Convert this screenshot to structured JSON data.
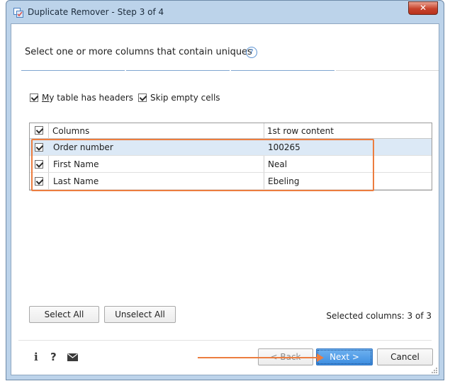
{
  "window": {
    "title": "Duplicate Remover - Step 3 of 4",
    "close_label": "✕"
  },
  "header": {
    "instruction": "Select one or more columns that contain uniques",
    "help_glyph": "?"
  },
  "options": {
    "has_headers_prefix": "M",
    "has_headers_rest": "y table has headers",
    "has_headers_checked": true,
    "skip_empty_label": "Skip empty cells",
    "skip_empty_checked": true
  },
  "grid": {
    "columns": [
      "Columns",
      "1st row content"
    ],
    "rows": [
      {
        "name": "Order number",
        "content": "100265",
        "checked": true
      },
      {
        "name": "First Name",
        "content": "Neal",
        "checked": true
      },
      {
        "name": "Last Name",
        "content": "Ebeling",
        "checked": true
      }
    ]
  },
  "buttons": {
    "select_all": "Select All",
    "unselect_all": "Unselect All",
    "back": "< Back",
    "next": "Next >",
    "cancel": "Cancel"
  },
  "status": {
    "selected_columns": "Selected columns: 3 of 3"
  },
  "footer_icons": {
    "info": "i",
    "help": "?"
  },
  "colors": {
    "accent_orange": "#ec7d3f",
    "primary_blue": "#3c8de0",
    "selected_row": "#dce9f6"
  }
}
